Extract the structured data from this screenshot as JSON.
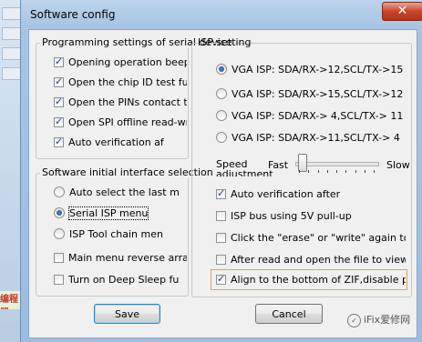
{
  "window": {
    "title": "Software config",
    "close_glyph": "✕"
  },
  "background": {
    "left_text": "编程器"
  },
  "programming": {
    "title": "Programming settings of serial device",
    "items": [
      {
        "label": "Opening operation beep",
        "checked": true
      },
      {
        "label": "Open the chip ID test fu",
        "checked": true
      },
      {
        "label": "Open the PINs contact test",
        "checked": true
      },
      {
        "label": "Open SPI offline read-write",
        "checked": true
      },
      {
        "label": "Auto verification af",
        "checked": true
      }
    ]
  },
  "interface": {
    "title": "Software initial interface selection",
    "radios": [
      {
        "label": "Auto select the last m",
        "checked": false
      },
      {
        "label": "Serial ISP menu",
        "checked": true
      },
      {
        "label": "ISP Tool chain men",
        "checked": false
      }
    ],
    "checks": [
      {
        "label": "Main menu reverse arrange",
        "checked": false
      },
      {
        "label": "Turn on Deep Sleep fu",
        "checked": false
      }
    ]
  },
  "isp": {
    "title": "ISP setting",
    "radios": [
      {
        "label": "VGA ISP: SDA/RX->12,SCL/TX->15",
        "checked": true
      },
      {
        "label": "VGA ISP: SDA/RX->15,SCL/TX->12",
        "checked": false
      },
      {
        "label": "VGA ISP: SDA/RX-> 4,SCL/TX-> 11",
        "checked": false
      },
      {
        "label": "VGA ISP: SDA/RX->11,SCL/TX-> 4",
        "checked": false
      }
    ],
    "speed": {
      "label_line1": "Speed",
      "label_line2": "adjustment",
      "fast": "Fast",
      "slow": "Slow",
      "value": 0.05
    },
    "checks": [
      {
        "label": "Auto verification after",
        "checked": true
      },
      {
        "label": "ISP bus using 5V pull-up",
        "checked": false
      },
      {
        "label": "Click the \"erase\" or \"write\" again to",
        "checked": false
      },
      {
        "label": "After read and open the file to view t",
        "checked": false
      },
      {
        "label": "Align to the bottom of ZIF,disable plac",
        "checked": true
      }
    ]
  },
  "buttons": {
    "save": "Save",
    "cancel": "Cancel"
  },
  "watermark": {
    "text": "iFix爱修网"
  },
  "colors": {
    "highlight_border": "#e0a060",
    "title_bar": "#a7c4e3",
    "close_button": "#c7452c"
  }
}
